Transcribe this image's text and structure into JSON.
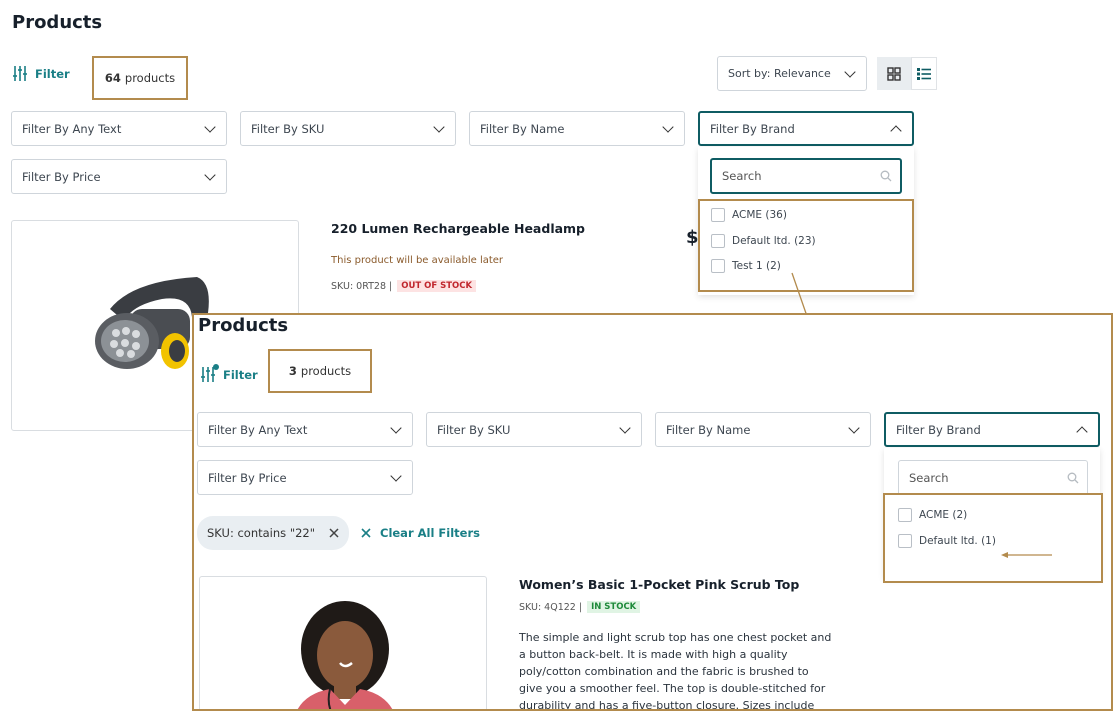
{
  "back": {
    "title": "Products",
    "filter_label": "Filter",
    "count_number": "64",
    "count_text": "products",
    "sort_prefix": "Sort by:",
    "sort_value": "Relevance",
    "filters": {
      "any_text": "Filter By Any Text",
      "sku": "Filter By SKU",
      "name": "Filter By Name",
      "brand": "Filter By Brand",
      "price": "Filter By Price"
    },
    "brand_dropdown": {
      "search_placeholder": "Search",
      "options": [
        "ACME (36)",
        "Default ltd. (23)",
        "Test 1 (2)"
      ]
    },
    "product": {
      "name": "220 Lumen Rechargeable Headlamp",
      "availability": "This product will be available later",
      "sku": "SKU: 0RT28 |",
      "stock": "OUT OF STOCK",
      "price_symbol": "$"
    }
  },
  "front": {
    "title": "Products",
    "filter_label": "Filter",
    "count_number": "3",
    "count_text": "products",
    "filters": {
      "any_text": "Filter By Any Text",
      "sku": "Filter By SKU",
      "name": "Filter By Name",
      "brand": "Filter By Brand",
      "price": "Filter By Price"
    },
    "brand_dropdown": {
      "search_placeholder": "Search",
      "options": [
        "ACME (2)",
        "Default ltd. (1)"
      ]
    },
    "active_chip": "SKU:  contains \"22\"",
    "clear_all": "Clear All Filters",
    "product": {
      "name": "Women’s Basic 1-Pocket Pink Scrub Top",
      "sku": "SKU: 4Q122 |",
      "stock": "IN STOCK",
      "description": [
        "The simple and light scrub top has one chest pocket and",
        "a button back-belt. It is made with high a quality",
        "poly/cotton combination and the fabric is brushed to",
        "give you a smoother feel. The top is double-stitched for",
        "durability and has a five-button closure. Sizes include"
      ]
    }
  },
  "colors": {
    "accent_teal": "#1a7f86",
    "active_border": "#0f5c63",
    "highlight": "#b38b4d",
    "out_of_stock": "#c0262d",
    "in_stock": "#1e8a3a"
  }
}
